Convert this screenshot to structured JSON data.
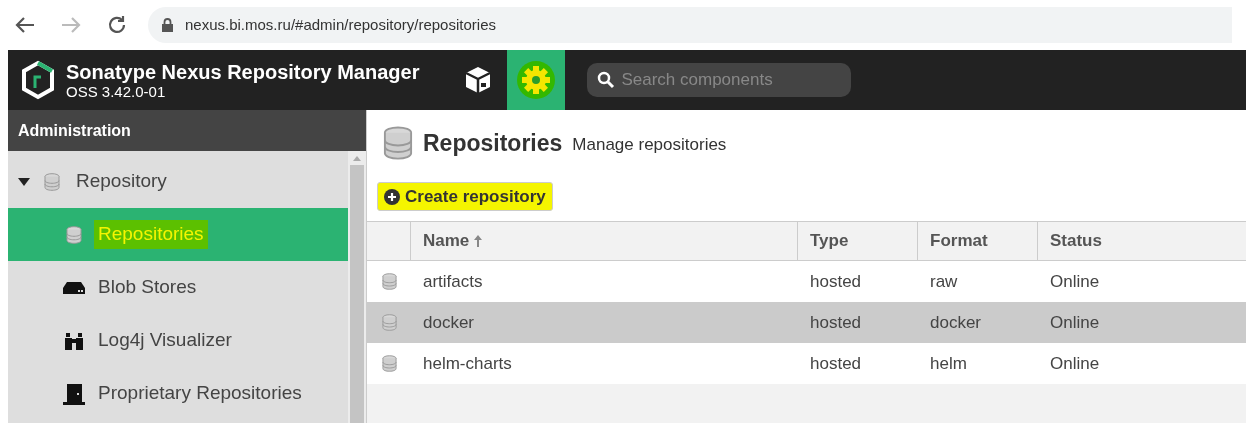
{
  "browser": {
    "url": "nexus.bi.mos.ru/#admin/repository/repositories"
  },
  "header": {
    "title": "Sonatype Nexus Repository Manager",
    "version": "OSS 3.42.0-01",
    "nav": [
      {
        "kind": "browse",
        "selected": false,
        "highlighted": false
      },
      {
        "kind": "admin",
        "selected": true,
        "highlighted": true
      }
    ],
    "search": {
      "placeholder": "Search components"
    }
  },
  "sidebar": {
    "title": "Administration",
    "items": [
      {
        "label": "Repository",
        "kind": "database",
        "expanded": true,
        "selected": false,
        "highlighted": false,
        "children": [
          {
            "label": "Repositories",
            "kind": "database",
            "selected": true,
            "highlighted": true
          },
          {
            "label": "Blob Stores",
            "kind": "drive",
            "selected": false,
            "highlighted": false
          },
          {
            "label": "Log4j Visualizer",
            "kind": "binoculars",
            "selected": false,
            "highlighted": false
          },
          {
            "label": "Proprietary Repositories",
            "kind": "door",
            "selected": false,
            "highlighted": false
          }
        ]
      }
    ]
  },
  "page": {
    "title": "Repositories",
    "subtitle": "Manage repositories",
    "create_button": {
      "label": "Create repository",
      "highlighted": true
    }
  },
  "table": {
    "columns": [
      {
        "label": "Name",
        "sorted": true
      },
      {
        "label": "Type",
        "sorted": false
      },
      {
        "label": "Format",
        "sorted": false
      },
      {
        "label": "Status",
        "sorted": false
      }
    ],
    "rows": [
      {
        "cells": [
          "artifacts",
          "hosted",
          "raw",
          "Online"
        ],
        "selected": false
      },
      {
        "cells": [
          "docker",
          "hosted",
          "docker",
          "Online"
        ],
        "selected": true
      },
      {
        "cells": [
          "helm-charts",
          "hosted",
          "helm",
          "Online"
        ],
        "selected": false
      }
    ]
  }
}
